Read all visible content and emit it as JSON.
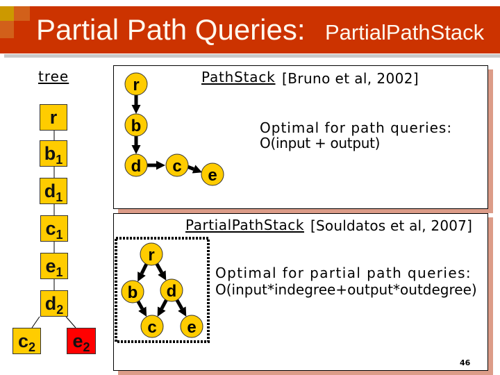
{
  "slide": {
    "title_main": "Partial Path Queries:",
    "title_sub": "PartialPathStack",
    "page_number": "46"
  },
  "tree": {
    "label": "tree",
    "nodes": [
      {
        "base": "r",
        "sub": ""
      },
      {
        "base": "b",
        "sub": "1"
      },
      {
        "base": "d",
        "sub": "1"
      },
      {
        "base": "c",
        "sub": "1"
      },
      {
        "base": "e",
        "sub": "1"
      },
      {
        "base": "d",
        "sub": "2"
      },
      {
        "base": "c",
        "sub": "2"
      },
      {
        "base": "e",
        "sub": "2",
        "highlighted": true
      }
    ]
  },
  "pathstack": {
    "name": "PathStack",
    "citation": "[Bruno et al, 2002]",
    "description_line1": "Optimal for path queries:",
    "description_line2": "O(input + output)",
    "query_nodes": [
      "r",
      "b",
      "d",
      "c",
      "e"
    ]
  },
  "partialpathstack": {
    "name": "PartialPathStack",
    "citation": "[Souldatos et al, 2007]",
    "description_line1": "Optimal for partial path queries:",
    "description_line2": "O(input*indegree+output*outdegree)",
    "query_nodes": [
      "r",
      "b",
      "d",
      "c",
      "e"
    ]
  },
  "colors": {
    "header": "#cc3300",
    "node_fill": "#ffcc00",
    "highlight_node": "#ff0000",
    "panel_shadow": "#dc9c88"
  }
}
